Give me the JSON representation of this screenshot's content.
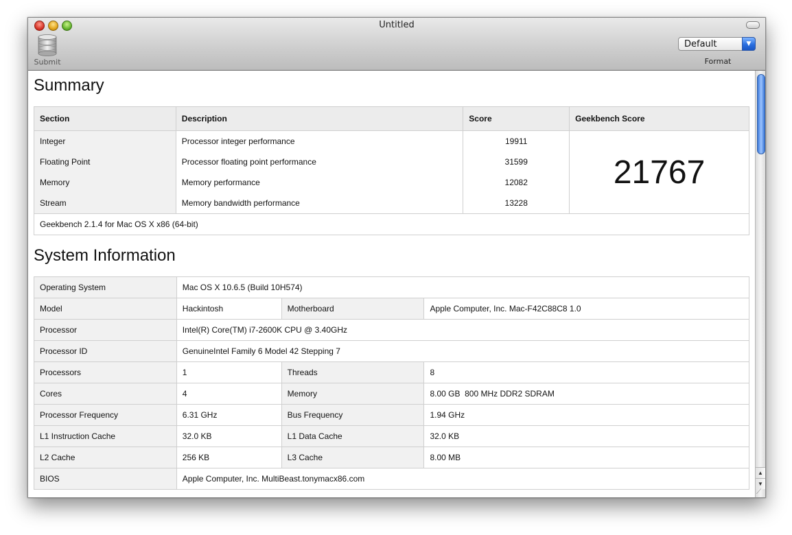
{
  "window": {
    "title": "Untitled"
  },
  "toolbar": {
    "submit_label": "Submit",
    "format_value": "Default",
    "format_label": "Format"
  },
  "summary": {
    "heading": "Summary",
    "columns": [
      "Section",
      "Description",
      "Score",
      "Geekbench Score"
    ],
    "rows": [
      {
        "section": "Integer",
        "description": "Processor integer performance",
        "score": "19911"
      },
      {
        "section": "Floating Point",
        "description": "Processor floating point performance",
        "score": "31599"
      },
      {
        "section": "Memory",
        "description": "Memory performance",
        "score": "12082"
      },
      {
        "section": "Stream",
        "description": "Memory bandwidth performance",
        "score": "13228"
      }
    ],
    "geekbench_score": "21767",
    "footer": "Geekbench 2.1.4 for Mac OS X x86 (64-bit)"
  },
  "system": {
    "heading": "System Information",
    "os_label": "Operating System",
    "os_value": "Mac OS X 10.6.5 (Build 10H574)",
    "model_label": "Model",
    "model_value": "Hackintosh",
    "motherboard_label": "Motherboard",
    "motherboard_value": "Apple Computer, Inc. Mac-F42C88C8 1.0",
    "processor_label": "Processor",
    "processor_value": "Intel(R) Core(TM) i7-2600K CPU @ 3.40GHz",
    "processor_id_label": "Processor ID",
    "processor_id_value": "GenuineIntel Family 6 Model 42 Stepping 7",
    "processors_label": "Processors",
    "processors_value": "1",
    "threads_label": "Threads",
    "threads_value": "8",
    "cores_label": "Cores",
    "cores_value": "4",
    "memory_label": "Memory",
    "memory_value": "8.00 GB  800 MHz DDR2 SDRAM",
    "proc_freq_label": "Processor Frequency",
    "proc_freq_value": "6.31 GHz",
    "bus_freq_label": "Bus Frequency",
    "bus_freq_value": "1.94 GHz",
    "l1i_label": "L1 Instruction Cache",
    "l1i_value": "32.0 KB",
    "l1d_label": "L1 Data Cache",
    "l1d_value": "32.0 KB",
    "l2_label": "L2 Cache",
    "l2_value": "256 KB",
    "l3_label": "L3 Cache",
    "l3_value": "8.00 MB",
    "bios_label": "BIOS",
    "bios_value": "Apple Computer, Inc. MultiBeast.tonymacx86.com"
  },
  "icons": {
    "submit": "database-icon",
    "scroll_up": "arrow-up-icon",
    "scroll_down": "arrow-down-icon",
    "resize": "resize-grip-icon"
  },
  "colors": {
    "accent": "#2a6fe0",
    "label_cell": "#f1f1f1",
    "header_cell": "#ececec"
  }
}
